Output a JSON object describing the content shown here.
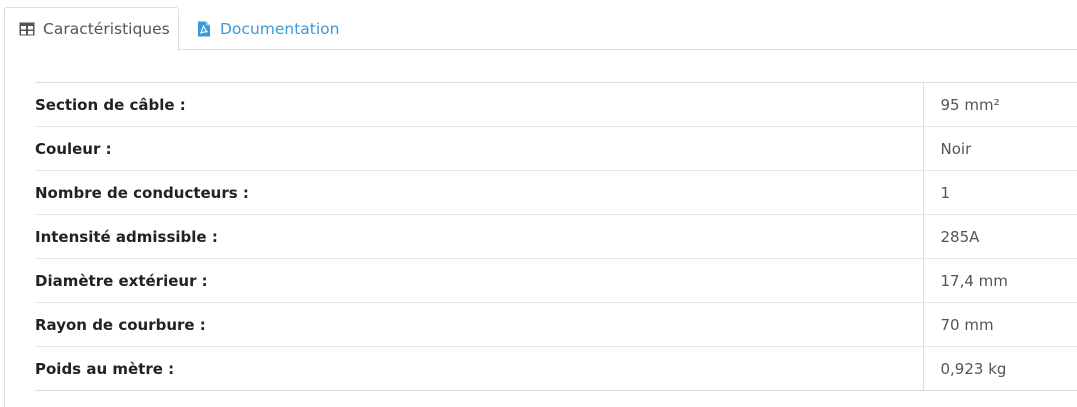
{
  "tabs": {
    "active": {
      "label": "Caractéristiques",
      "icon": "table-icon"
    },
    "inactive": {
      "label": "Documentation",
      "icon": "pdf-file-icon"
    }
  },
  "colors": {
    "link": "#3a9ad9",
    "border": "#dddddd",
    "label_text": "#222222",
    "value_text": "#555555"
  },
  "specs": [
    {
      "label": "Section de câble :",
      "value": "95 mm²"
    },
    {
      "label": "Couleur :",
      "value": "Noir"
    },
    {
      "label": "Nombre de conducteurs :",
      "value": "1"
    },
    {
      "label": "Intensité admissible :",
      "value": "285A"
    },
    {
      "label": "Diamètre extérieur :",
      "value": "17,4 mm"
    },
    {
      "label": "Rayon de courbure :",
      "value": "70 mm"
    },
    {
      "label": "Poids au mètre :",
      "value": "0,923 kg"
    }
  ]
}
